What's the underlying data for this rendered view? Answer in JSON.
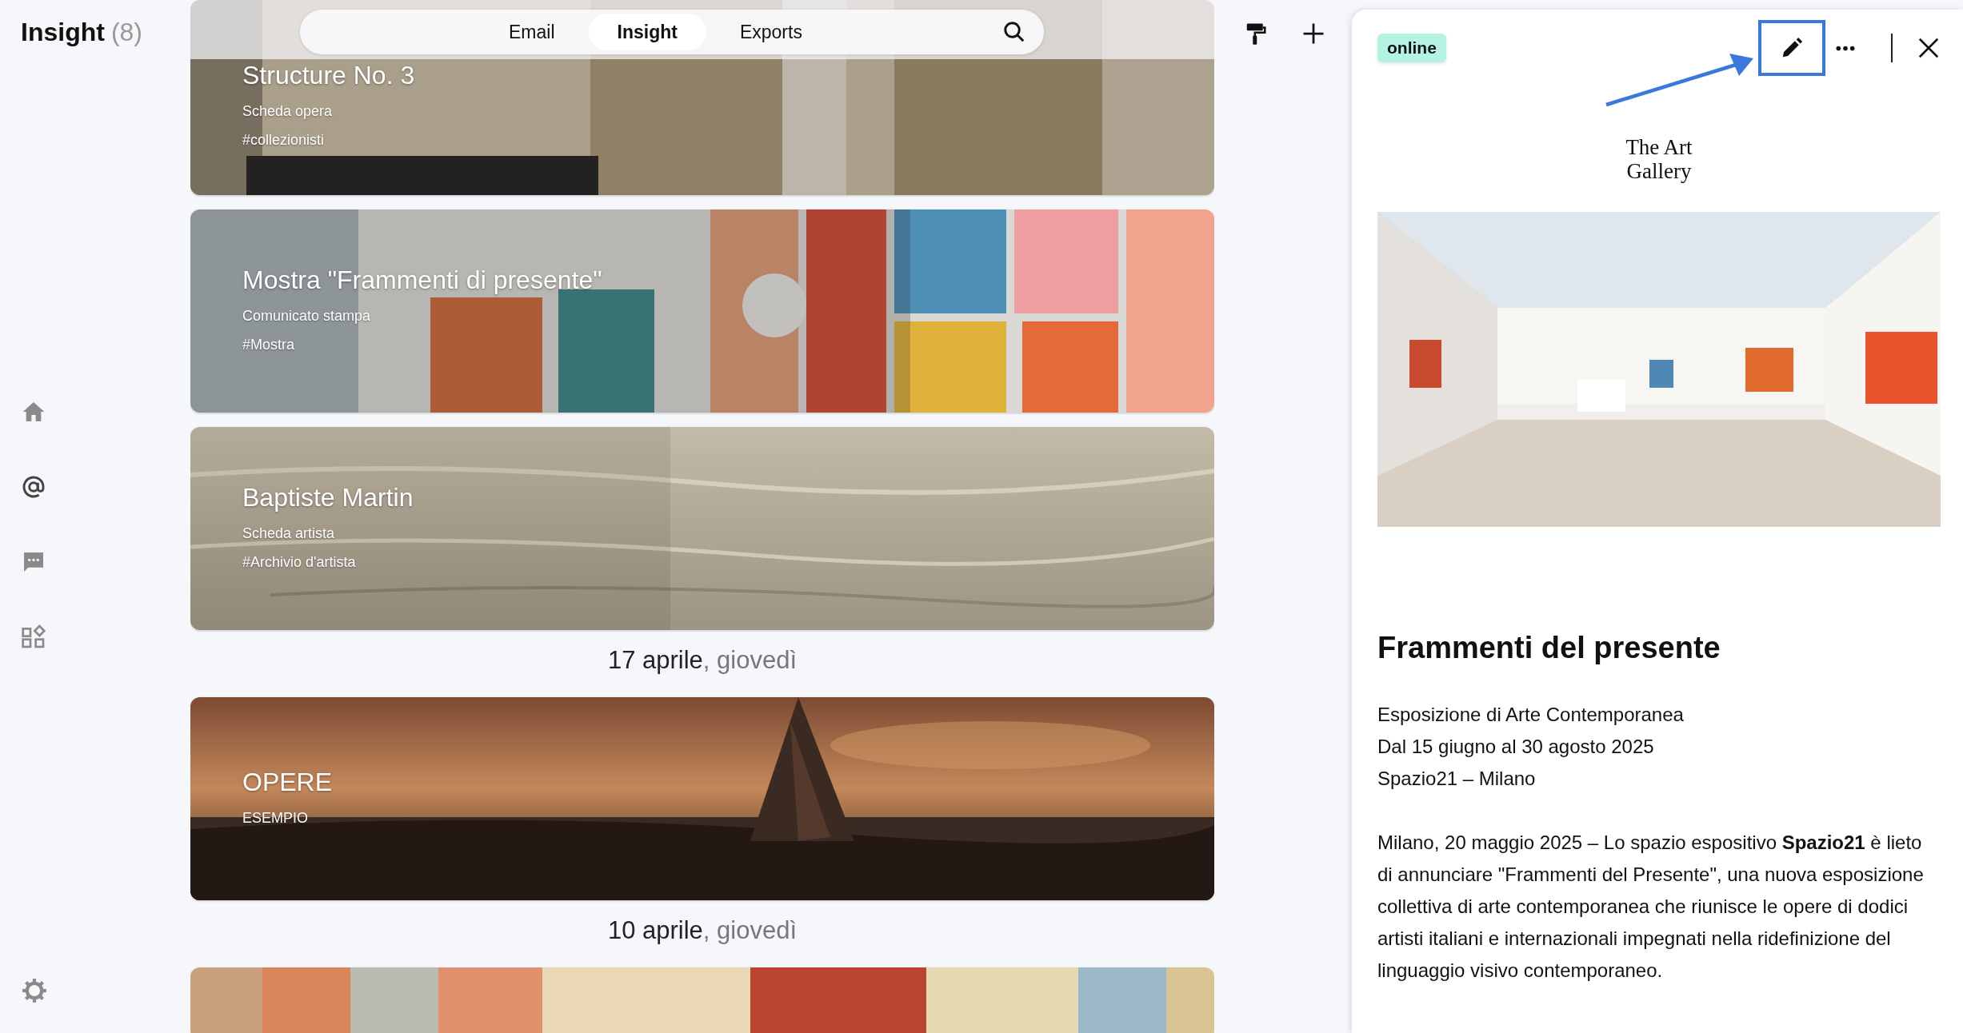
{
  "app": {
    "title": "Insight",
    "count": "(8)"
  },
  "nav": {
    "tabs": [
      {
        "label": "Email",
        "selected": false
      },
      {
        "label": "Insight",
        "selected": true
      },
      {
        "label": "Exports",
        "selected": false
      }
    ]
  },
  "feed": [
    {
      "kind": "card",
      "title": "Structure No. 3",
      "subtitle": "Scheda opera",
      "tag": "#collezionisti"
    },
    {
      "kind": "card",
      "title": "Mostra \"Frammenti di presente\"",
      "subtitle": "Comunicato stampa",
      "tag": "#Mostra"
    },
    {
      "kind": "card",
      "title": "Baptiste Martin",
      "subtitle": "Scheda artista",
      "tag": "#Archivio d'artista"
    },
    {
      "kind": "date",
      "date": "17 aprile",
      "weekday": ", giovedì"
    },
    {
      "kind": "card",
      "title": "OPERE",
      "subtitle": "ESEMPIO"
    },
    {
      "kind": "date",
      "date": "10 aprile",
      "weekday": ", giovedì"
    },
    {
      "kind": "card"
    }
  ],
  "detail": {
    "status": "online",
    "logo": "The Art\nGallery",
    "title": "Frammenti del presente",
    "info_lines": [
      "Esposizione di Arte Contemporanea",
      "Dal 15 giugno al 30 agosto 2025",
      "Spazio21 – Milano"
    ],
    "body": "Milano, 20 maggio 2025 – Lo spazio espositivo **Spazio21** è lieto di annunciare \"Frammenti del Presente\", una nuova esposizione collettiva di arte contemporanea che riunisce le opere di dodici artisti italiani e internazionali impegnati nella ridefinizione del linguaggio visivo contemporaneo."
  }
}
